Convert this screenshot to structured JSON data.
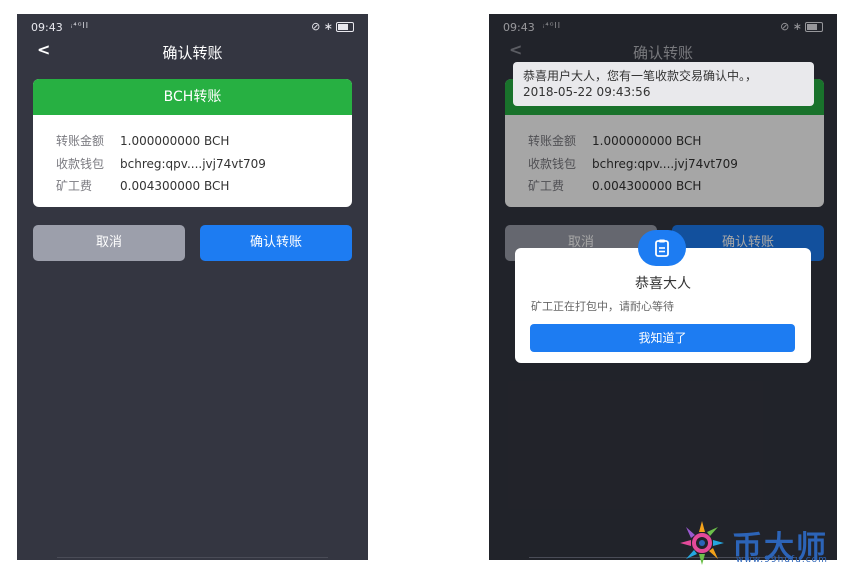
{
  "status": {
    "time": "09:43",
    "net": "ᵢ⁴ᴳll",
    "right_icons": "⊘ ∗"
  },
  "left": {
    "title": "确认转账",
    "card_header": "BCH转账",
    "rows": [
      {
        "label": "转账金额",
        "value": "1.000000000 BCH"
      },
      {
        "label": "收款钱包",
        "value": "bchreg:qpv....jvj74vt709"
      },
      {
        "label": "矿工费",
        "value": "0.004300000 BCH"
      }
    ],
    "cancel_label": "取消",
    "confirm_label": "确认转账"
  },
  "right": {
    "title": "确认转账",
    "toast_line1": "恭喜用户大人，您有一笔收款交易确认中。，",
    "toast_line2": "2018-05-22 09:43:56",
    "rows": [
      {
        "label": "转账金额",
        "value": "1.000000000 BCH"
      },
      {
        "label": "收款钱包",
        "value": "bchreg:qpv....jvj74vt709"
      },
      {
        "label": "矿工费",
        "value": "0.004300000 BCH"
      }
    ],
    "cancel_label": "取消",
    "confirm_label": "确认转账",
    "dialog_title": "恭喜大人",
    "dialog_message": "矿工正在打包中，请耐心等待",
    "dialog_button": "我知道了"
  },
  "watermark": {
    "brand": "币大师",
    "url": "www.99hufu.com"
  },
  "colors": {
    "accent": "#1d7cf2",
    "success": "#27b042",
    "background": "#343641"
  }
}
